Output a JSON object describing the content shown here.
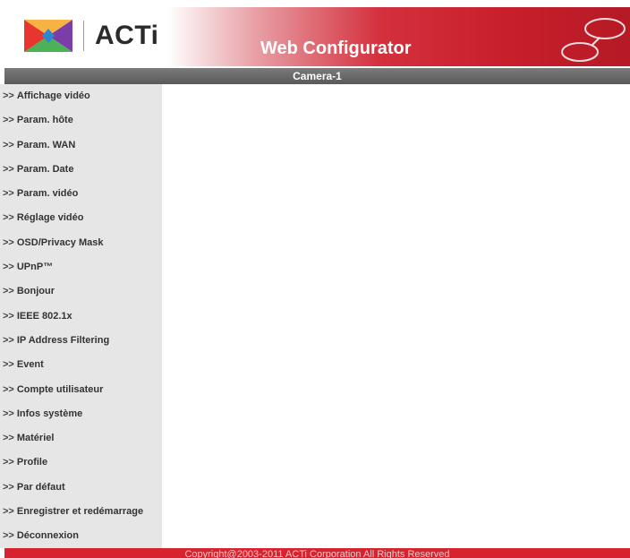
{
  "header": {
    "logo_text": "ACTi",
    "title": "Web Configurator"
  },
  "camera_name": "Camera-1",
  "sidebar": {
    "arrow": ">>",
    "items": [
      "Affichage vidéo",
      "Param. hôte",
      "Param. WAN",
      "Param. Date",
      "Param. vidéo",
      "Réglage vidéo",
      "OSD/Privacy Mask",
      "UPnP™",
      "Bonjour",
      "IEEE 802.1x",
      "IP Address Filtering",
      "Event",
      "Compte utilisateur",
      "Infos système",
      "Matériel",
      "Profile",
      "Par défaut",
      "Enregistrer et redémarrage",
      "Déconnexion"
    ]
  },
  "footer": {
    "copyright": "Copyright@2003-2011 ACTi Corporation All Rights Reserved"
  },
  "colors": {
    "brand_red": "#d6232e",
    "bar_gray": "#666666",
    "sidebar_bg": "#e6e6e6"
  }
}
